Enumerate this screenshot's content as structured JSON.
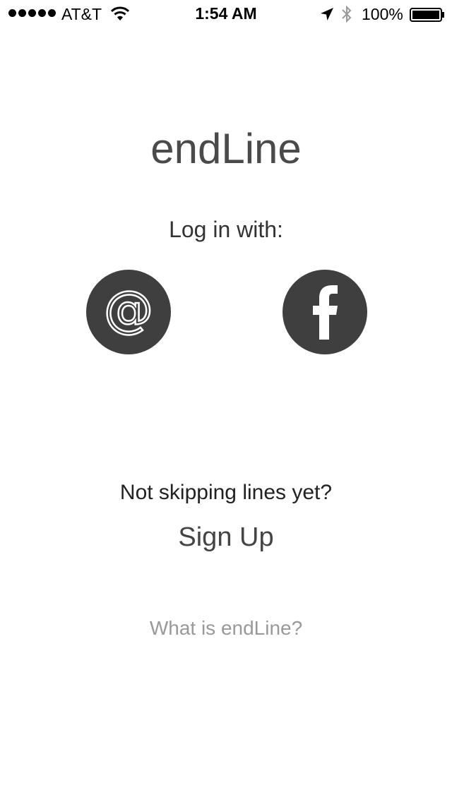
{
  "status_bar": {
    "carrier": "AT&T",
    "time": "1:54 AM",
    "battery": "100%",
    "icons": [
      "signal-dots",
      "wifi-icon",
      "location-arrow-icon",
      "bluetooth-icon",
      "battery-icon"
    ]
  },
  "app": {
    "title": "endLine"
  },
  "login": {
    "prompt": "Log in with:",
    "email_icon": "at-sign-icon",
    "email_glyph": "@",
    "facebook_icon": "facebook-icon",
    "button_color": "#3f3f3f"
  },
  "signup": {
    "tagline": "Not skipping lines yet?",
    "label": "Sign Up"
  },
  "about": {
    "label": "What is endLine?"
  }
}
